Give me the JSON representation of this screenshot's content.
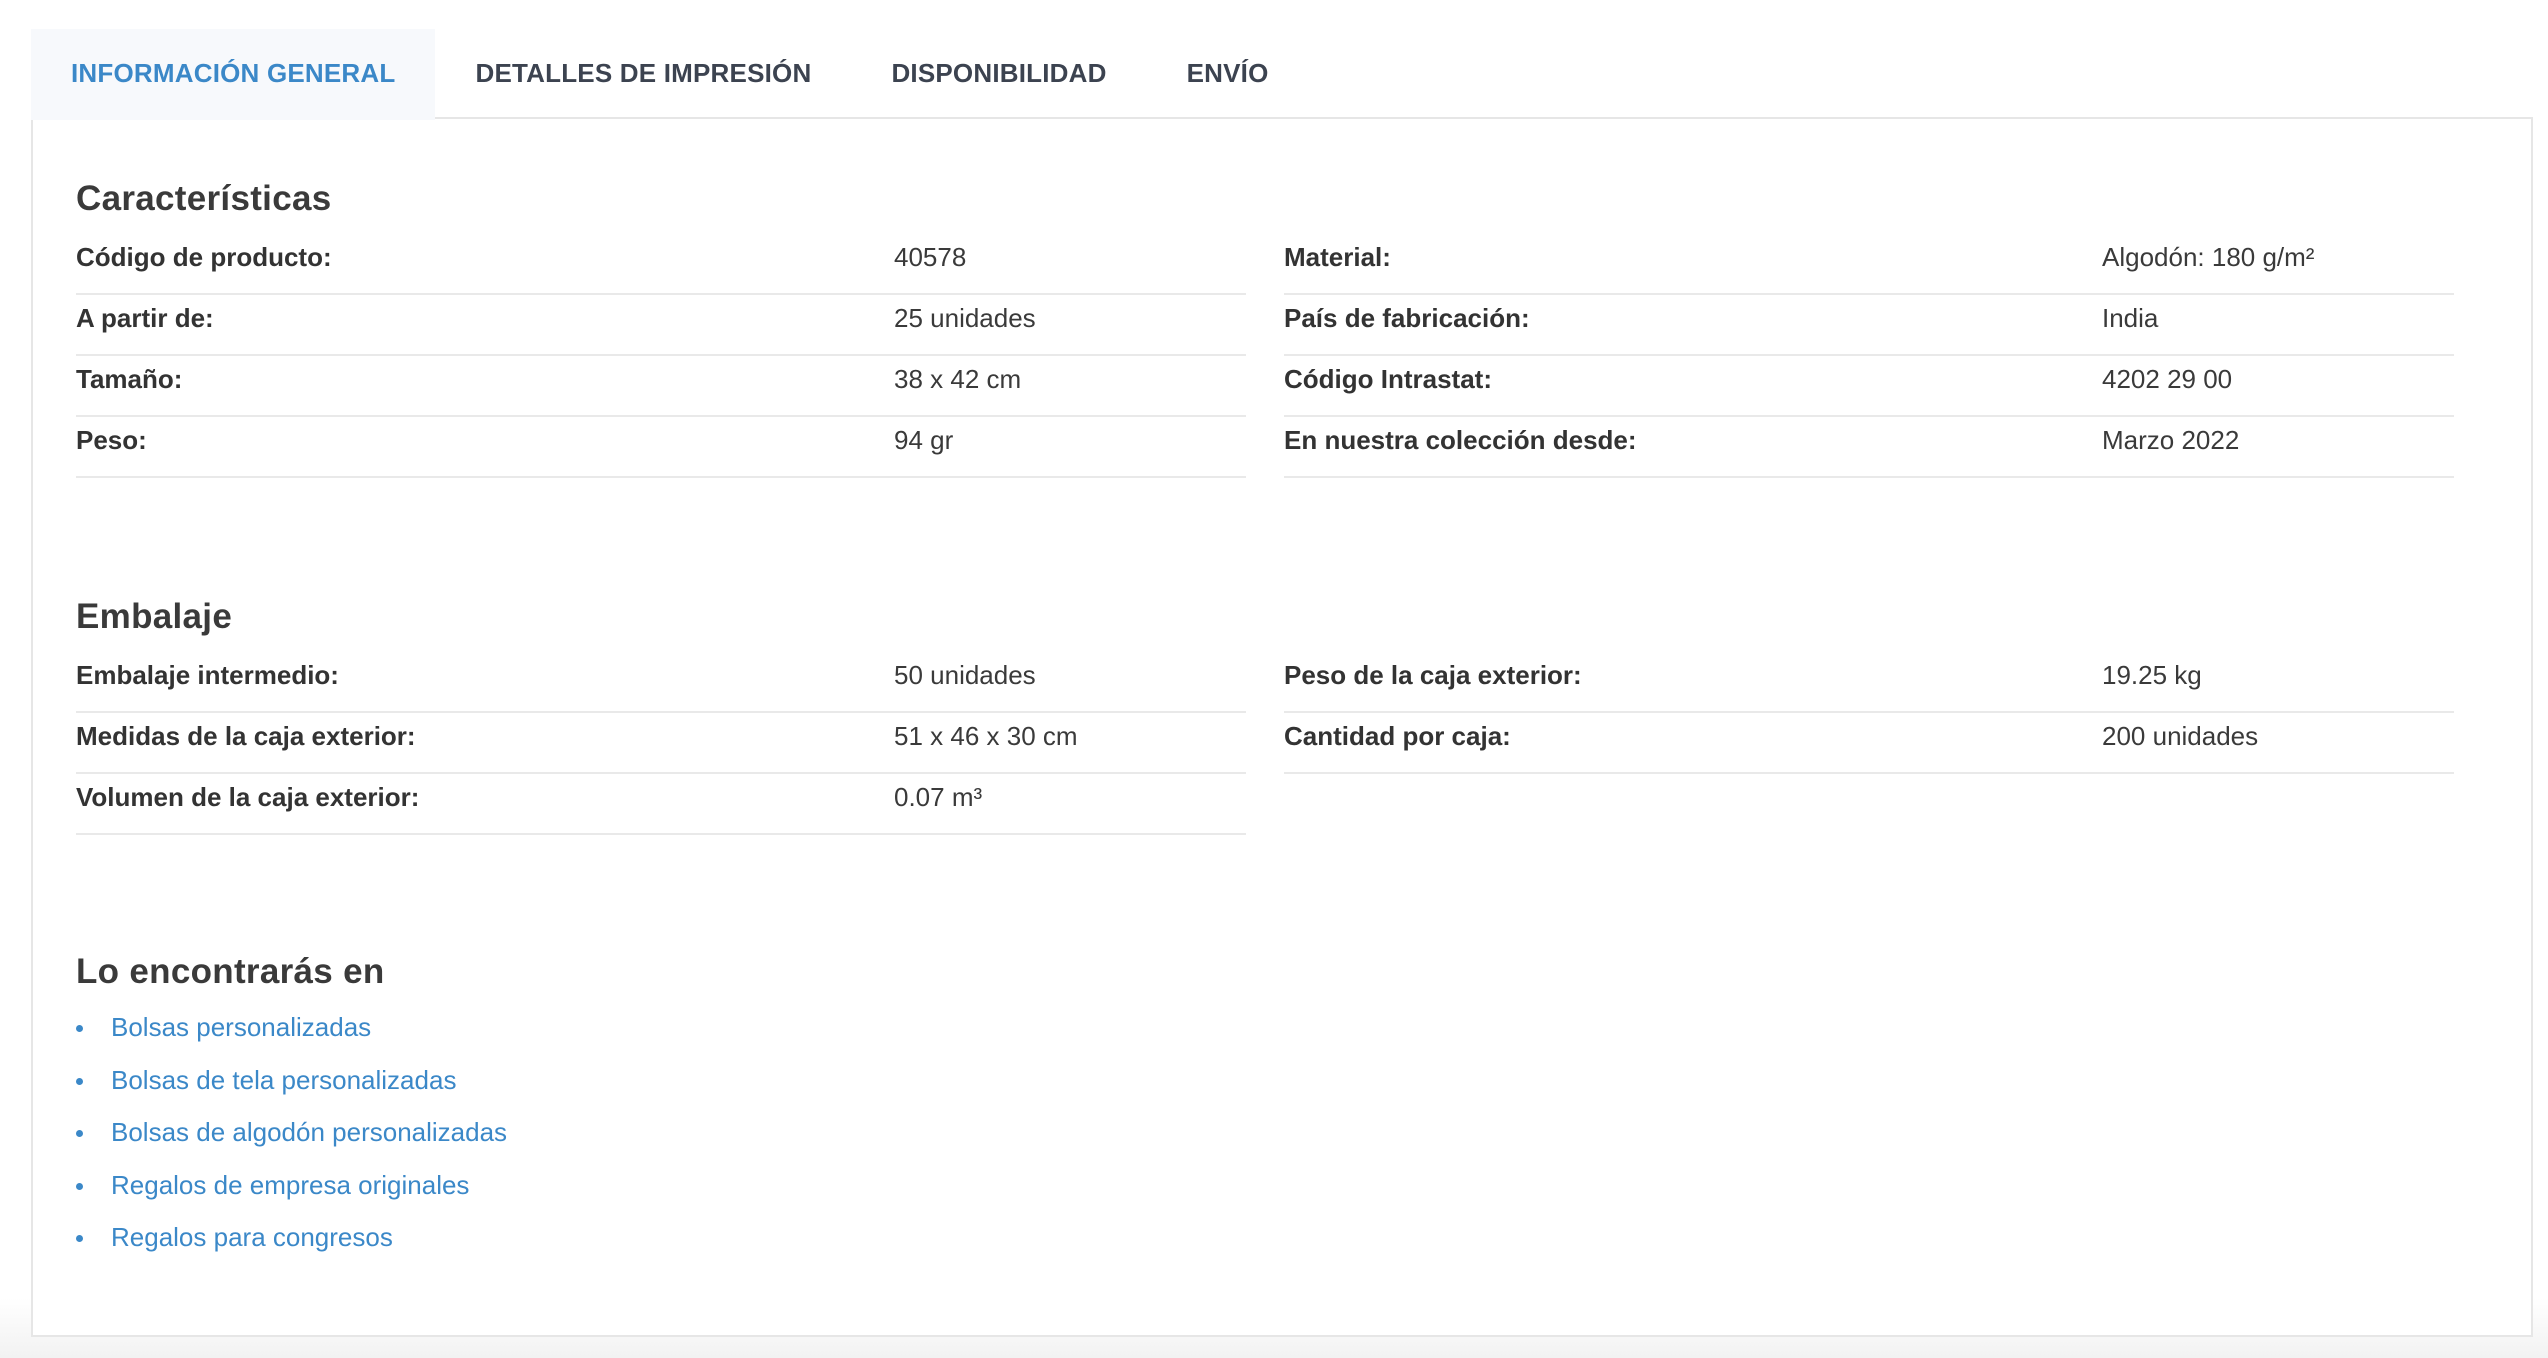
{
  "tabs": [
    {
      "label": "INFORMACIÓN GENERAL",
      "active": true
    },
    {
      "label": "DETALLES DE IMPRESIÓN",
      "active": false
    },
    {
      "label": "DISPONIBILIDAD",
      "active": false
    },
    {
      "label": "ENVÍO",
      "active": false
    }
  ],
  "caracteristicas": {
    "title": "Características",
    "left": [
      {
        "label": "Código de producto:",
        "value": "40578"
      },
      {
        "label": "A partir de:",
        "value": "25 unidades"
      },
      {
        "label": "Tamaño:",
        "value": "38 x 42 cm"
      },
      {
        "label": "Peso:",
        "value": "94 gr"
      }
    ],
    "right": [
      {
        "label": "Material:",
        "value": "Algodón: 180 g/m²"
      },
      {
        "label": "País de fabricación:",
        "value": "India"
      },
      {
        "label": "Código Intrastat:",
        "value": "4202 29 00"
      },
      {
        "label": "En nuestra colección desde:",
        "value": "Marzo 2022"
      }
    ]
  },
  "embalaje": {
    "title": "Embalaje",
    "left": [
      {
        "label": "Embalaje intermedio:",
        "value": "50 unidades"
      },
      {
        "label": "Medidas de la caja exterior:",
        "value": "51 x 46 x 30 cm"
      },
      {
        "label": "Volumen de la caja exterior:",
        "value": "0.07 m³"
      }
    ],
    "right": [
      {
        "label": "Peso de la caja exterior:",
        "value": "19.25 kg"
      },
      {
        "label": "Cantidad por caja:",
        "value": "200 unidades"
      }
    ]
  },
  "encontraras": {
    "title": "Lo encontrarás en",
    "links": [
      "Bolsas personalizadas",
      "Bolsas de tela personalizadas",
      "Bolsas de algodón personalizadas",
      "Regalos de empresa originales",
      "Regalos para congresos"
    ]
  },
  "colors": {
    "accent": "#3b88c8",
    "text": "#3a3a3a",
    "border": "#e6e6e6"
  }
}
